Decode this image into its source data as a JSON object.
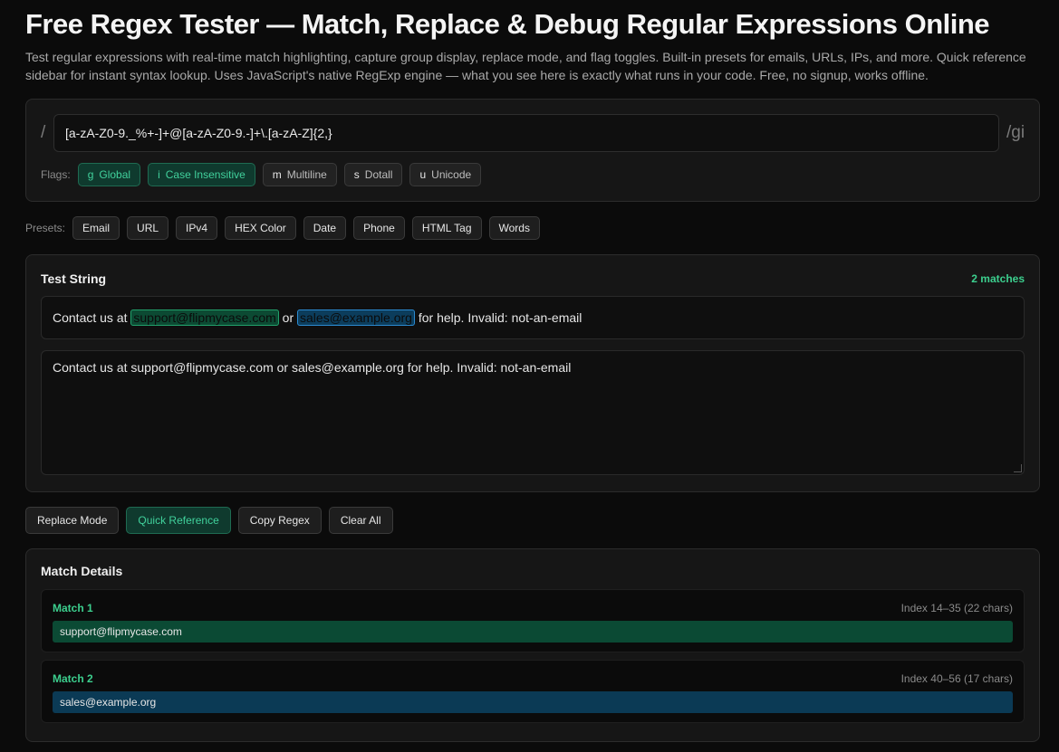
{
  "page": {
    "title": "Free Regex Tester — Match, Replace & Debug Regular Expressions Online",
    "subtitle": "Test regular expressions with real-time match highlighting, capture group display, replace mode, and flag toggles. Built-in presets for emails, URLs, IPs, and more. Quick reference sidebar for instant syntax lookup. Uses JavaScript's native RegExp engine — what you see here is exactly what runs in your code. Free, no signup, works offline."
  },
  "regex": {
    "open_slash": "/",
    "pattern": "[a-zA-Z0-9._%+-]+@[a-zA-Z0-9.-]+\\.[a-zA-Z]{2,}",
    "flags_display": "/gi",
    "flags_label": "Flags:",
    "flags": [
      {
        "key": "g",
        "label": "Global",
        "active": true
      },
      {
        "key": "i",
        "label": "Case Insensitive",
        "active": true
      },
      {
        "key": "m",
        "label": "Multiline",
        "active": false
      },
      {
        "key": "s",
        "label": "Dotall",
        "active": false
      },
      {
        "key": "u",
        "label": "Unicode",
        "active": false
      }
    ]
  },
  "presets": {
    "label": "Presets:",
    "items": [
      "Email",
      "URL",
      "IPv4",
      "HEX Color",
      "Date",
      "Phone",
      "HTML Tag",
      "Words"
    ]
  },
  "test": {
    "title": "Test String",
    "match_count": "2 matches",
    "highlight": {
      "before": "Contact us at ",
      "match1": "support@flipmycase.com",
      "between": " or ",
      "match2": "sales@example.org",
      "after": " for help. Invalid: not-an-email"
    },
    "input_value": "Contact us at support@flipmycase.com or sales@example.org for help. Invalid: not-an-email"
  },
  "actions": {
    "replace": "Replace Mode",
    "reference": "Quick Reference",
    "copy": "Copy Regex",
    "clear": "Clear All"
  },
  "details": {
    "title": "Match Details",
    "matches": [
      {
        "label": "Match 1",
        "index": "Index 14–35 (22 chars)",
        "value": "support@flipmycase.com"
      },
      {
        "label": "Match 2",
        "index": "Index 40–56 (17 chars)",
        "value": "sales@example.org"
      }
    ]
  },
  "colors": {
    "accent": "#3ccf8e",
    "match1_bg": "#0b4a34",
    "match2_bg": "#0b3a55"
  }
}
